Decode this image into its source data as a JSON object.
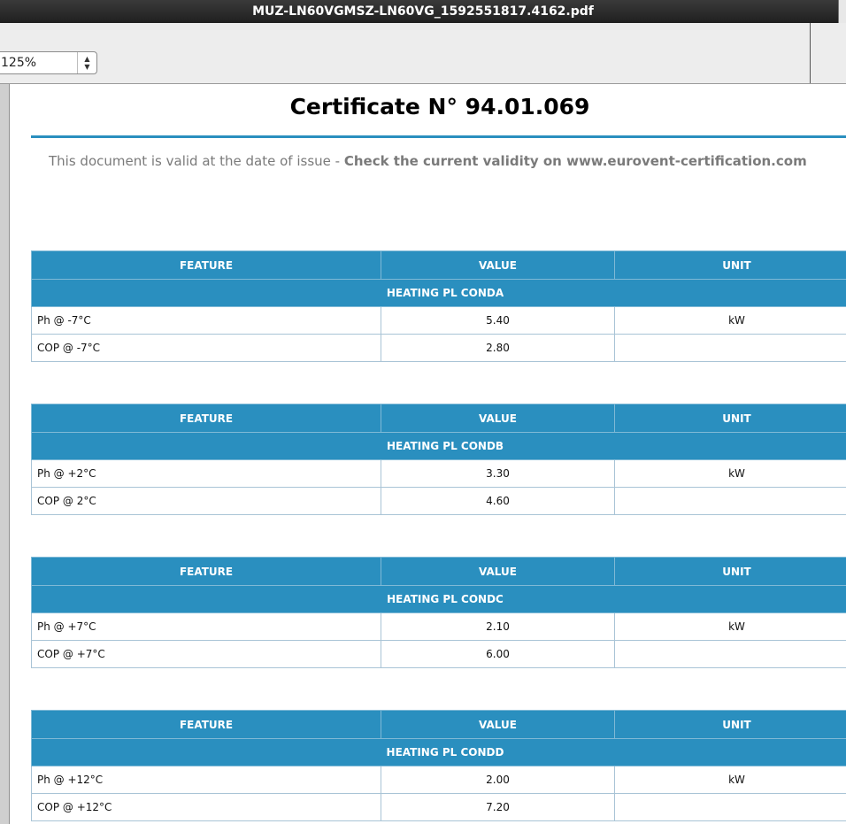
{
  "window": {
    "title": "MUZ-LN60VGMSZ-LN60VG_1592551817.4162.pdf"
  },
  "toolbar": {
    "zoom_value": "125%"
  },
  "document": {
    "title": "Certificate N° 94.01.069",
    "validity_prefix": "This document is valid at the date of issue - ",
    "validity_bold": "Check the current validity on www.eurovent-certification.com"
  },
  "headers": {
    "feature": "FEATURE",
    "value": "VALUE",
    "unit": "UNIT"
  },
  "tables": [
    {
      "section": "HEATING PL CONDA",
      "rows": [
        {
          "feature": "Ph @ -7°C",
          "value": "5.40",
          "unit": "kW"
        },
        {
          "feature": "COP @ -7°C",
          "value": "2.80",
          "unit": ""
        }
      ]
    },
    {
      "section": "HEATING PL CONDB",
      "rows": [
        {
          "feature": "Ph @ +2°C",
          "value": "3.30",
          "unit": "kW"
        },
        {
          "feature": "COP @ 2°C",
          "value": "4.60",
          "unit": ""
        }
      ]
    },
    {
      "section": "HEATING PL CONDC",
      "rows": [
        {
          "feature": "Ph @ +7°C",
          "value": "2.10",
          "unit": "kW"
        },
        {
          "feature": "COP @ +7°C",
          "value": "6.00",
          "unit": ""
        }
      ]
    },
    {
      "section": "HEATING PL CONDD",
      "rows": [
        {
          "feature": "Ph @ +12°C",
          "value": "2.00",
          "unit": "kW"
        },
        {
          "feature": "COP @ +12°C",
          "value": "7.20",
          "unit": ""
        }
      ]
    }
  ],
  "colors": {
    "accent": "#2a8fbf",
    "titlebar": "#1f1f1f"
  }
}
